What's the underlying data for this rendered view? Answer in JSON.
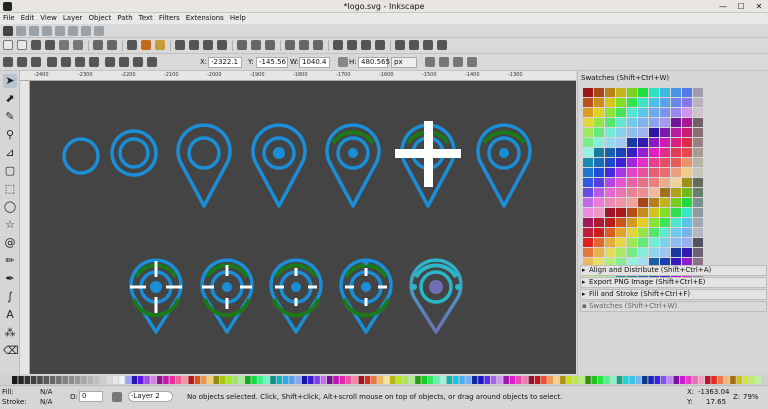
{
  "window": {
    "title": "*logo.svg - Inkscape",
    "min": "—",
    "max": "☐",
    "close": "✕"
  },
  "menu": [
    "File",
    "Edit",
    "View",
    "Layer",
    "Object",
    "Path",
    "Text",
    "Filters",
    "Extensions",
    "Help"
  ],
  "toolbar": {
    "x_label": "X:",
    "x_value": "-2322.1",
    "y_label": "Y:",
    "y_value": "-145.56",
    "w_label": "W:",
    "w_value": "1040.4",
    "h_label": "H:",
    "h_value": "480.565",
    "unit": "px"
  },
  "ruler": {
    "h_ticks": [
      "-2400",
      "-2300",
      "-2200",
      "-2100",
      "-2000",
      "-1900",
      "-1800",
      "-1700",
      "-1600",
      "-1500",
      "-1400",
      "-1300"
    ]
  },
  "tools": [
    "select-tool",
    "node-tool",
    "tweak-tool",
    "zoom-tool",
    "measure-tool",
    "rect-tool",
    "box3d-tool",
    "ellipse-tool",
    "star-tool",
    "spiral-tool",
    "pencil-tool",
    "pen-tool",
    "calligraphy-tool",
    "text-tool",
    "spray-tool",
    "eraser-tool",
    "bucket-tool",
    "gradient-tool",
    "mesh-tool",
    "dropper-tool"
  ],
  "dock": {
    "swatches_title": "Swatches (Shift+Ctrl+W)",
    "panels": [
      {
        "label": "Align and Distribute (Shift+Ctrl+A)"
      },
      {
        "label": "Export PNG Image (Shift+Ctrl+E)"
      },
      {
        "label": "Fill and Stroke (Shift+Ctrl+F)"
      },
      {
        "label": "Swatches (Shift+Ctrl+W)"
      }
    ]
  },
  "status": {
    "fill_label": "Fill:",
    "fill_value": "N/A",
    "stroke_label": "Stroke:",
    "stroke_value": "N/A",
    "opacity_label": "O:",
    "opacity_value": "0",
    "layer": "-Layer 2",
    "message": "No objects selected. Click, Shift+click, Alt+scroll mouse on top of objects, or drag around objects to select.",
    "x_label": "X:",
    "x_value": "-1363.04",
    "y_label": "Y:",
    "y_value": "17.65",
    "z_label": "Z:",
    "zoom": "79%"
  },
  "colors": {
    "blue": "#1a8fd8",
    "green": "#1a7a1a",
    "white": "#ffffff",
    "teal": "#2ab7c9",
    "purple": "#6f6fb5",
    "canvas": "#444444"
  }
}
